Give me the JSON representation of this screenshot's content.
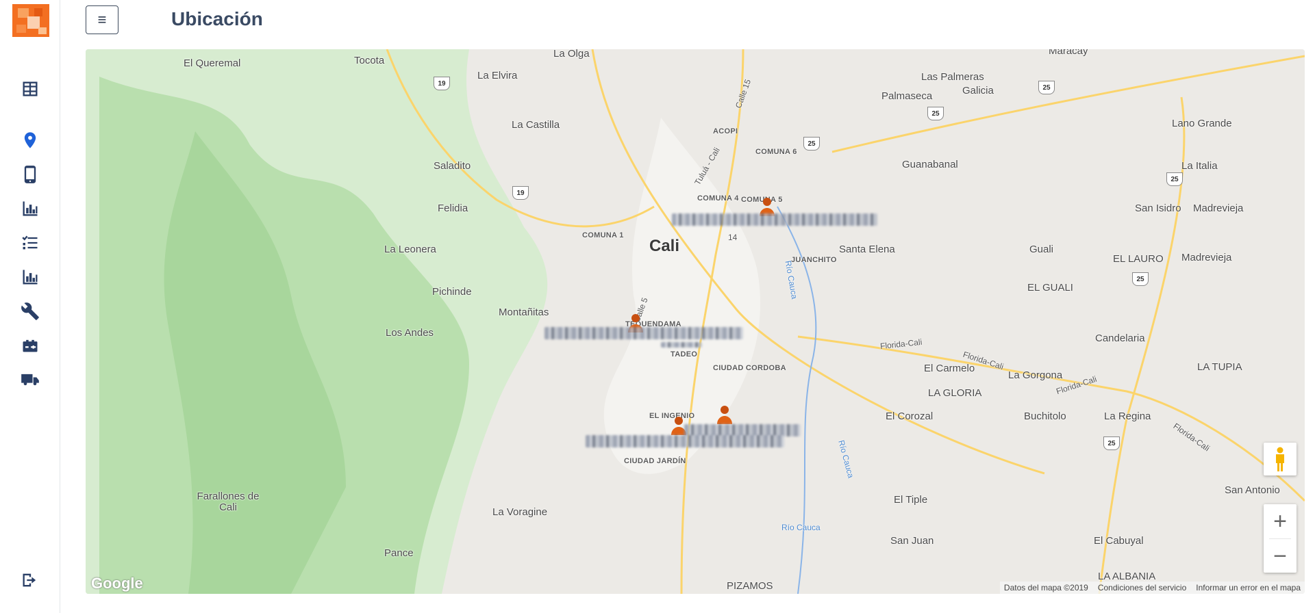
{
  "page": {
    "title": "Ubicación"
  },
  "sidebar": {
    "items": [
      {
        "icon": "table-icon",
        "name": "sidebar-item-dashboard"
      },
      {
        "icon": "location-pin-icon",
        "name": "sidebar-item-location",
        "active": true
      },
      {
        "icon": "mobile-phone-icon",
        "name": "sidebar-item-devices"
      },
      {
        "icon": "bar-chart-icon",
        "name": "sidebar-item-reports"
      },
      {
        "icon": "checklist-icon",
        "name": "sidebar-item-tasks"
      },
      {
        "icon": "bar-chart-icon",
        "name": "sidebar-item-statistics"
      },
      {
        "icon": "wrench-icon",
        "name": "sidebar-item-maintenance"
      },
      {
        "icon": "battery-icon",
        "name": "sidebar-item-batteries"
      },
      {
        "icon": "truck-icon",
        "name": "sidebar-item-vehicles"
      }
    ],
    "logout_icon": "logout-icon"
  },
  "map": {
    "places": {
      "el_queremal": "El Queremal",
      "tocota": "Tocota",
      "la_olga": "La Olga",
      "la_elvira": "La Elvira",
      "la_castilla": "La Castilla",
      "saladito": "Saladito",
      "felidia": "Felidia",
      "la_leonera": "La Leonera",
      "pichinde": "Pichinde",
      "montanitas": "Montañitas",
      "los_andes": "Los Andes",
      "cali": "Cali",
      "comuna_1": "COMUNA 1",
      "comuna_4": "COMUNA 4",
      "comuna_5": "COMUNA 5",
      "comuna_6": "COMUNA 6",
      "acopi": "ACOPI",
      "juanchito": "JUANCHITO",
      "tequendama": "TEQUENDAMA",
      "tadeo": "TADEO",
      "ciudad_cordoba": "CIUDAD CORDOBA",
      "el_ingenio": "EL INGENIO",
      "ciudad_jardin": "CIUDAD JARDÍN",
      "farallones": "Farallones de Cali",
      "la_voragine": "La Voragine",
      "pance": "Pance",
      "pizamos": "PIZAMOS",
      "maracay": "Maracay",
      "las_palmeras": "Las Palmeras",
      "palmaseca": "Palmaseca",
      "galicia": "Galicia",
      "lano_grande": "Lano Grande",
      "guanabanal": "Guanabanal",
      "la_italia": "La Italia",
      "san_isidro": "San Isidro",
      "madrevieja": "Madrevieja",
      "madrevieja2": "Madrevieja",
      "santa_elena": "Santa Elena",
      "guali": "Guali",
      "el_lauro": "EL LAURO",
      "el_guali": "EL GUALI",
      "candelaria": "Candelaria",
      "el_carmelo": "El Carmelo",
      "la_gorgona": "La Gorgona",
      "la_tupia": "LA TUPIA",
      "la_gloria": "LA GLORIA",
      "el_corozal": "El Corozal",
      "buchitolo": "Buchitolo",
      "la_regina": "La Regina",
      "san_antonio": "San Antonio",
      "el_tiple": "El Tiple",
      "san_juan": "San Juan",
      "el_cabuyal": "El Cabuyal",
      "la_albania": "LA ALBANIA",
      "calle_15": "Calle 15",
      "calle_5": "Calle 5",
      "tulua_cali": "Tuluá - Cali",
      "florida_cali_1": "Florida-Cali",
      "florida_cali_2": "Florida-Cali",
      "florida_cali_3": "Florida-Cali",
      "florida_cali_4": "Florida-Cali",
      "rio_cauca_1": "Río Cauca",
      "rio_cauca_2": "Río Cauca",
      "rio_cauca_3": "Río Cauca",
      "road_14": "14"
    },
    "shields": {
      "s19a": "19",
      "s19b": "19",
      "s25a": "25",
      "s25b": "25",
      "s25c": "25",
      "s25d": "25",
      "s25e": "25",
      "s25f": "25"
    },
    "google": "Google",
    "attribution": {
      "data": "Datos del mapa ©2019",
      "terms": "Condiciones del servicio",
      "report": "Informar un error en el mapa"
    },
    "zoom_in": "+",
    "zoom_out": "−"
  }
}
